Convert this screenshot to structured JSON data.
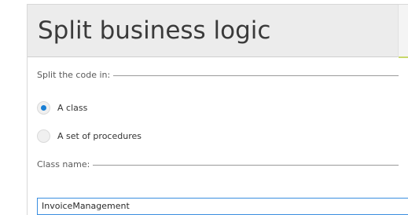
{
  "dialog": {
    "title": "Split business logic"
  },
  "split_section": {
    "label": "Split the code in:",
    "options": [
      {
        "label": "A class",
        "selected": true
      },
      {
        "label": "A set of procedures",
        "selected": false
      }
    ]
  },
  "class_section": {
    "label": "Class name:",
    "input_value": "InvoiceManagement"
  },
  "colors": {
    "header_bg": "#ececec",
    "radio_selected": "#1a7fd4",
    "input_border": "#3a8ee0"
  }
}
